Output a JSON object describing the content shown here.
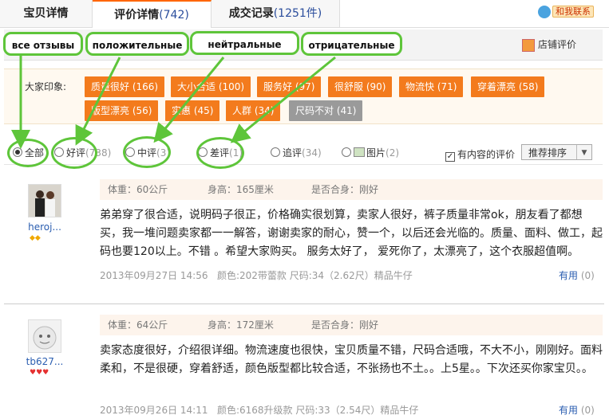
{
  "tabs": [
    {
      "label": "宝贝详情",
      "count": ""
    },
    {
      "label": "评价详情",
      "count": "(742)"
    },
    {
      "label": "成交记录",
      "count": "(1251件)"
    }
  ],
  "contact_button": {
    "label": "和我联系",
    "icon": "chat-icon"
  },
  "annotations": {
    "all": "все отзывы",
    "positive": "положительные",
    "neutral": "нейтральные",
    "negative": "отрицательные"
  },
  "shop_rating": {
    "label": "店铺评价",
    "icon": "shop-rating-icon"
  },
  "impressions": {
    "label": "大家印象:",
    "tags": [
      {
        "text": "质量很好 (166)",
        "color": "#f37b1d"
      },
      {
        "text": "大小合适 (100)",
        "color": "#f37b1d"
      },
      {
        "text": "服务好 (97)",
        "color": "#f37b1d"
      },
      {
        "text": "很舒服 (90)",
        "color": "#f37b1d"
      },
      {
        "text": "物流快 (71)",
        "color": "#f37b1d"
      },
      {
        "text": "穿着漂亮 (58)",
        "color": "#f37b1d"
      },
      {
        "text": "版型漂亮 (56)",
        "color": "#f37b1d"
      },
      {
        "text": "实惠 (45)",
        "color": "#f37b1d"
      },
      {
        "text": "人群 (34)",
        "color": "#f37b1d"
      },
      {
        "text": "尺码不对 (41)",
        "color": "#9a9a9a"
      }
    ]
  },
  "filters": [
    {
      "label": "全部",
      "count": "",
      "selected": true
    },
    {
      "label": "好评",
      "count": "(738)",
      "selected": false
    },
    {
      "label": "中评",
      "count": "(3)",
      "selected": false
    },
    {
      "label": "差评",
      "count": "(1)",
      "selected": false
    },
    {
      "label": "追评",
      "count": "(34)",
      "selected": false
    },
    {
      "label": "图片",
      "count": "(2)",
      "selected": false
    }
  ],
  "content_only": {
    "label": "有内容的评价",
    "checked": true
  },
  "sort": {
    "selected": "推荐排序"
  },
  "reviews": [
    {
      "user": "heroj...",
      "weight": "体重：60公斤",
      "height": "身高：165厘米",
      "fit": "是否合身：刚好",
      "text": "弟弟穿了很合适，说明码子很正，价格确实很划算，卖家人很好，裤子质量非常ok，朋友看了都想买，我一堆问题卖家都一一解答，谢谢卖家的耐心，赞一个，以后还会光临的。质量、面料、做工，起码也要120以上。不错 。希望大家购买。 服务太好了， 爱死你了，太漂亮了，这个衣服超值啊。",
      "date": "2013年09月27日 14:56",
      "attrs": "颜色:202带蕾款  尺码:34（2.62尺）精品牛仔",
      "useful": "有用",
      "useful_count": "(0)",
      "badge": "◆◆"
    },
    {
      "user": "tb627...",
      "weight": "体重：64公斤",
      "height": "身高：172厘米",
      "fit": "是否合身：刚好",
      "text": "卖家态度很好，介绍很详细。物流速度也很快，宝贝质量不错，尺码合适哦，不大不小，刚刚好。面料柔和，不是很硬，穿着舒适，颜色版型都比较合适，不张扬也不土。。上5星。。下次还买你家宝贝。。",
      "date": "2013年09月26日 14:11",
      "attrs": "颜色:6168升级款  尺码:33（2.54尺）精品牛仔",
      "useful": "有用",
      "useful_count": "(0)",
      "badge": "♥♥♥"
    }
  ]
}
